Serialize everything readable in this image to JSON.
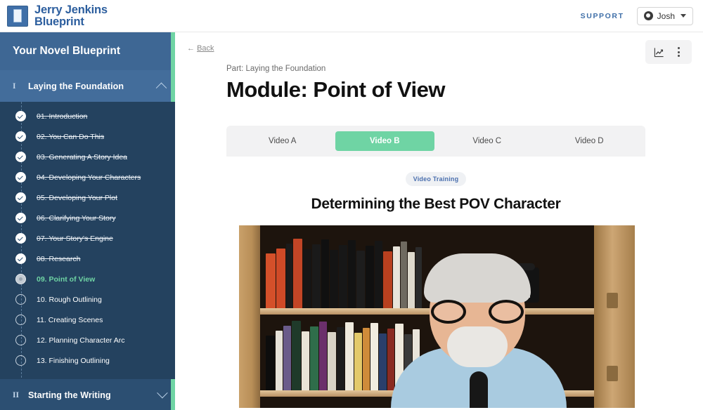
{
  "topbar": {
    "brand_line1": "Jerry Jenkins",
    "brand_line2": "Blueprint",
    "logo_icon": "book-page-icon",
    "support_label": "SUPPORT",
    "user_name": "Josh",
    "user_icon": "user-avatar-icon",
    "caret_icon": "chevron-down-icon"
  },
  "sidebar": {
    "title": "Your Novel Blueprint",
    "sections": [
      {
        "numeral": "I",
        "title": "Laying the Foundation",
        "expanded": true,
        "chevron_icon": "chevron-up-icon",
        "items": [
          {
            "number": "01.",
            "label": "Introduction",
            "state": "done"
          },
          {
            "number": "02.",
            "label": "You Can Do This",
            "state": "done"
          },
          {
            "number": "03.",
            "label": "Generating A Story Idea",
            "state": "done"
          },
          {
            "number": "04.",
            "label": "Developing Your Characters",
            "state": "done"
          },
          {
            "number": "05.",
            "label": "Developing Your Plot",
            "state": "done"
          },
          {
            "number": "06.",
            "label": "Clarifying Your Story",
            "state": "done"
          },
          {
            "number": "07.",
            "label": "Your Story's Engine",
            "state": "done"
          },
          {
            "number": "08.",
            "label": "Research",
            "state": "done"
          },
          {
            "number": "09.",
            "label": "Point of View",
            "state": "current"
          },
          {
            "number": "10.",
            "label": "Rough Outlining",
            "state": "todo"
          },
          {
            "number": "11.",
            "label": "Creating Scenes",
            "state": "todo"
          },
          {
            "number": "12.",
            "label": "Planning Character Arc",
            "state": "todo"
          },
          {
            "number": "13.",
            "label": "Finishing Outlining",
            "state": "todo"
          }
        ]
      },
      {
        "numeral": "II",
        "title": "Starting the Writing",
        "expanded": false,
        "chevron_icon": "chevron-down-icon",
        "items": []
      }
    ]
  },
  "main": {
    "back_arrow": "←",
    "back_label": "Back",
    "analytics_icon": "chart-line-icon",
    "kebab_icon": "more-vertical-icon",
    "eyebrow": "Part: Laying the Foundation",
    "module_title": "Module: Point of View",
    "tabs": [
      {
        "label": "Video A",
        "active": false
      },
      {
        "label": "Video B",
        "active": true
      },
      {
        "label": "Video C",
        "active": false
      },
      {
        "label": "Video D",
        "active": false
      }
    ],
    "badge": "Video Training",
    "video_title": "Determining the Best POV Character",
    "video_alt": "Man with glasses and white beard in a blue shirt speaking in front of a wooden bookshelf with books, a vintage typewriter and a framed photo"
  },
  "colors": {
    "brand_blue": "#2c5e9e",
    "sidebar_bg": "#24425f",
    "sidebar_head": "#3e6794",
    "section_head": "#436d9b",
    "accent_green": "#6fd4a4",
    "text_dark": "#111111"
  }
}
